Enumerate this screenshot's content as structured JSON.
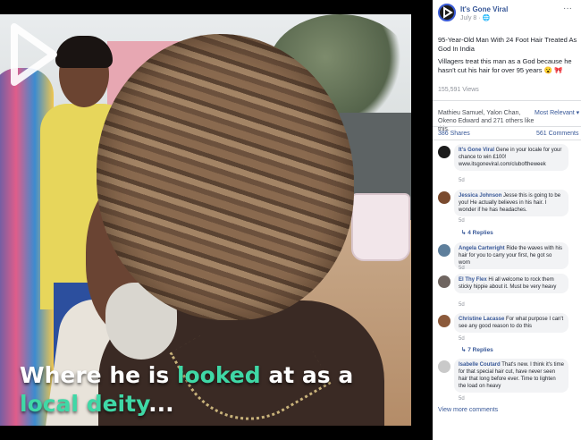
{
  "video": {
    "caption": {
      "part1": "Where he is ",
      "highlight1": "looked",
      "part2": " at as a ",
      "highlight2": "local deity",
      "part3": "..."
    }
  },
  "post": {
    "page_name": "It's Gone Viral",
    "date": "July 8 · ",
    "more": "···",
    "title": "95-Year-Old Man With 24 Foot Hair Treated As God In India",
    "text": "Villagers treat this man as a God because he hasn't cut his hair for over 95 years 😮 🎀",
    "views": "155,591 Views",
    "likes": "Mathieu Samuel, Yalon Chan, Okeno Edward and 271 others like this.",
    "sort": "Most Relevant ▾",
    "shares": "386 Shares",
    "comments_count": "561 Comments",
    "view_more": "View more comments"
  },
  "comments": [
    {
      "name": "It's Gone Viral",
      "text": "Gene in your locale for your chance to win £100! www.itsgoneviral.com/cluboftheweek",
      "meta": "5d",
      "avatar_color": "#1b1b1b"
    },
    {
      "name": "Jessica Johnson",
      "text": "Jesse this is going to be you! He actually believes in his hair. I wonder if he has headaches.",
      "meta": "5d",
      "replies": "↳ 4 Replies",
      "avatar_color": "#7a4a2e"
    },
    {
      "name": "Angela Cartwright",
      "text": "Ride the waves with his hair for you to carry your first, he got so worn",
      "meta": "5d",
      "avatar_color": "#5e7f9c"
    },
    {
      "name": "El Thy Flex",
      "text": "Hi all welcome to rock them sticky hippie about it. Must be very heavy",
      "meta": "5d",
      "avatar_color": "#6f6560"
    },
    {
      "name": "Christine Lacasse",
      "text": "For what purpose I can't see any good reason to do this",
      "meta": "5d",
      "replies": "↳ 7 Replies",
      "avatar_color": "#8c5a3b"
    },
    {
      "name": "Isabelle Coutard",
      "text": "That's new. I think it's time for that special hair cut, have never seen hair that long before ever. Time to lighten the load on heavy",
      "meta": "5d",
      "avatar_color": "#c9c9c9"
    }
  ]
}
